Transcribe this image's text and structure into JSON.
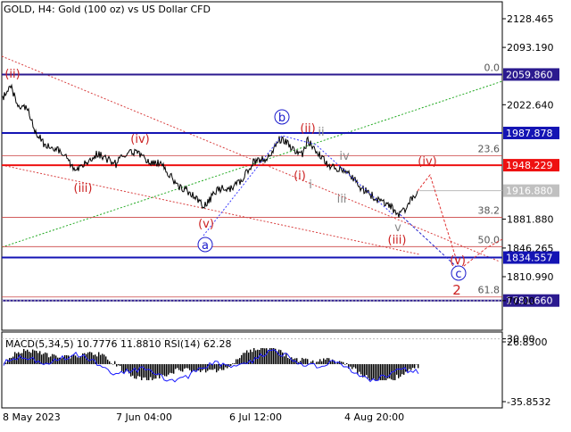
{
  "header": {
    "title": "GOLD, H4:  Gold (100 oz) vs US Dollar CFD"
  },
  "price_axis": {
    "ticks": [
      {
        "label": "2128.465",
        "value": 2128.465
      },
      {
        "label": "2093.190",
        "value": 2093.19
      },
      {
        "label": "2022.640",
        "value": 2022.64
      },
      {
        "label": "1881.880",
        "value": 1881.88
      },
      {
        "label": "1846.265",
        "value": 1846.265
      },
      {
        "label": "1810.990",
        "value": 1810.99
      }
    ],
    "current_price": {
      "label": "1916.880",
      "value": 1916.88,
      "color": "#c0c0c0"
    }
  },
  "levels": [
    {
      "label": "2059.860",
      "value": 2059.86,
      "color": "#2b1a8f"
    },
    {
      "label": "1987.878",
      "value": 1987.878,
      "color": "#1414b4"
    },
    {
      "label": "1948.229",
      "value": 1948.229,
      "color": "#ee1111"
    },
    {
      "label": "1834.557",
      "value": 1834.557,
      "color": "#1414b4"
    },
    {
      "label": "1781.660",
      "value": 1781.66,
      "color": "#2b1a8f"
    }
  ],
  "fibonacci": [
    {
      "label": "0.0",
      "value": 2059.86
    },
    {
      "label": "23.6",
      "value": 1960
    },
    {
      "label": "38.2",
      "value": 1884
    },
    {
      "label": "50.0",
      "value": 1848
    },
    {
      "label": "61.8",
      "value": 1786
    }
  ],
  "wave_labels": {
    "ii_major": "(ii)",
    "iii_major": "(iii)",
    "iv_major": "(iv)",
    "v_major": "(v)",
    "a": "a",
    "b": "b",
    "c": "c",
    "two": "2",
    "ii_peak": "(ii)",
    "i_mid": "(i)",
    "ii_minor": "ii",
    "i_minor": "i",
    "iii_minor": "iii",
    "iv_minor": "iv",
    "v_minor": "v",
    "iii_recent": "(iii)",
    "iv_future": "(iv)",
    "v_future": "(v)"
  },
  "indicator": {
    "title": "MACD(5,34,5) 10.7776 11.8810 RSI(14) 62.28",
    "ticks": [
      {
        "label": "26.8300",
        "value": 26.83
      },
      {
        "label": "70.00",
        "value": 70
      },
      {
        "label": "30.00",
        "value": 30
      },
      {
        "label": "-35.8532",
        "value": -35.8532
      }
    ]
  },
  "time_axis": {
    "labels": [
      "8 May 2023",
      "7 Jun 04:00",
      "6 Jul 12:00",
      "4 Aug 20:00"
    ]
  },
  "colors": {
    "wave_red": "#cc2222",
    "wave_blue": "#1a1acc",
    "wave_gray": "#888888",
    "price_line": "#000000",
    "green_dotted": "#22aa22"
  }
}
